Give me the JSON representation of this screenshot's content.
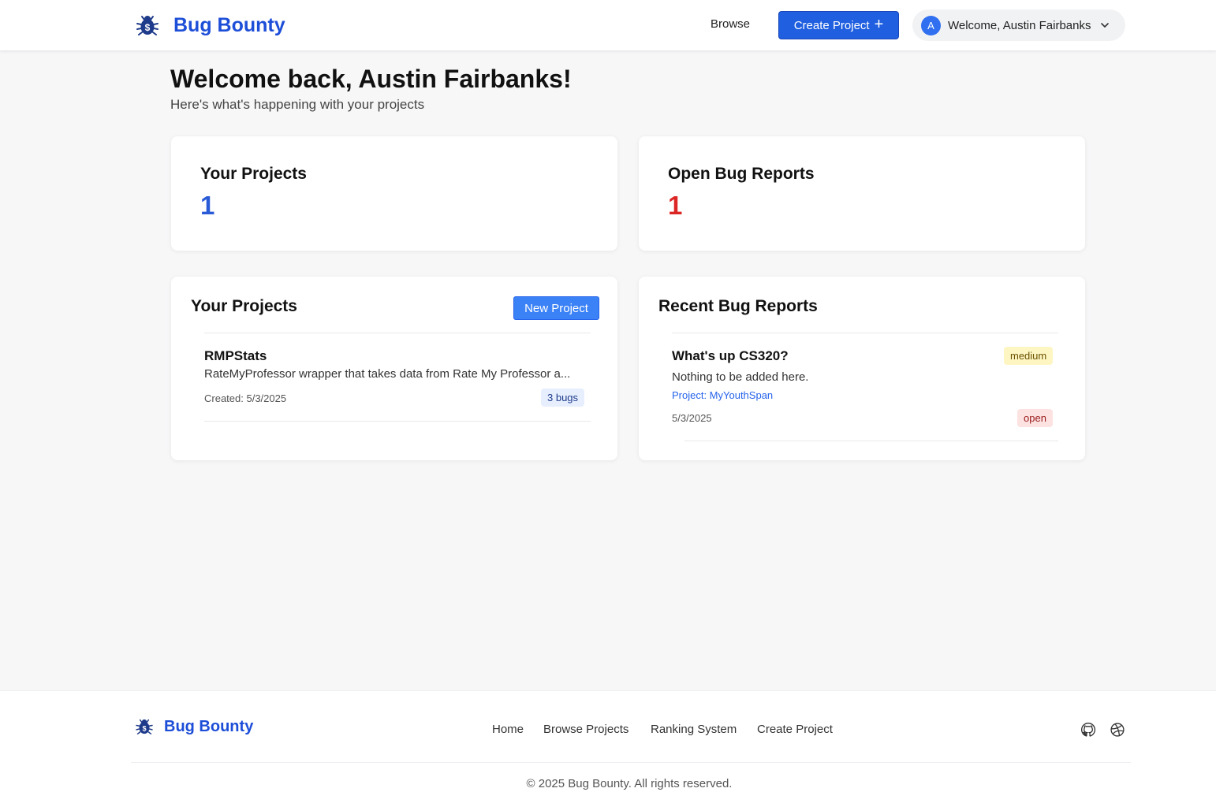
{
  "header": {
    "brand": "Bug Bounty",
    "browse": "Browse",
    "create_project": "Create Project",
    "avatar_initial": "A",
    "user_greeting": "Welcome, Austin Fairbanks"
  },
  "welcome": {
    "title": "Welcome back, Austin Fairbanks!",
    "subtitle": "Here's what's happening with your projects"
  },
  "stats": {
    "projects_label": "Your Projects",
    "projects_value": "1",
    "bugs_label": "Open Bug Reports",
    "bugs_value": "1"
  },
  "projects_section": {
    "title": "Your Projects",
    "new_button": "New Project",
    "items": [
      {
        "name": "RMPStats",
        "description": "RateMyProfessor wrapper that takes data from Rate My Professor a...",
        "created": "Created: 5/3/2025",
        "bugs": "3 bugs"
      }
    ]
  },
  "bugs_section": {
    "title": "Recent Bug Reports",
    "items": [
      {
        "title": "What's up CS320?",
        "description": "Nothing to be added here.",
        "project": "Project: MyYouthSpan",
        "date": "5/3/2025",
        "severity": "medium",
        "status": "open"
      }
    ]
  },
  "footer": {
    "brand": "Bug Bounty",
    "links": [
      "Home",
      "Browse Projects",
      "Ranking System",
      "Create Project"
    ],
    "copyright": "© 2025 Bug Bounty. All rights reserved."
  },
  "colors": {
    "primary": "#1d4ed8",
    "button": "#1f5fe0",
    "stat_blue": "#2a5bd7",
    "stat_red": "#dc2626",
    "medium_badge": "#fdf6c3",
    "open_badge": "#fde2e2",
    "bugs_badge": "#e7efff"
  },
  "icons": [
    "bug-logo-icon",
    "plus-icon",
    "chevron-down-icon",
    "github-icon",
    "dribbble-icon"
  ]
}
